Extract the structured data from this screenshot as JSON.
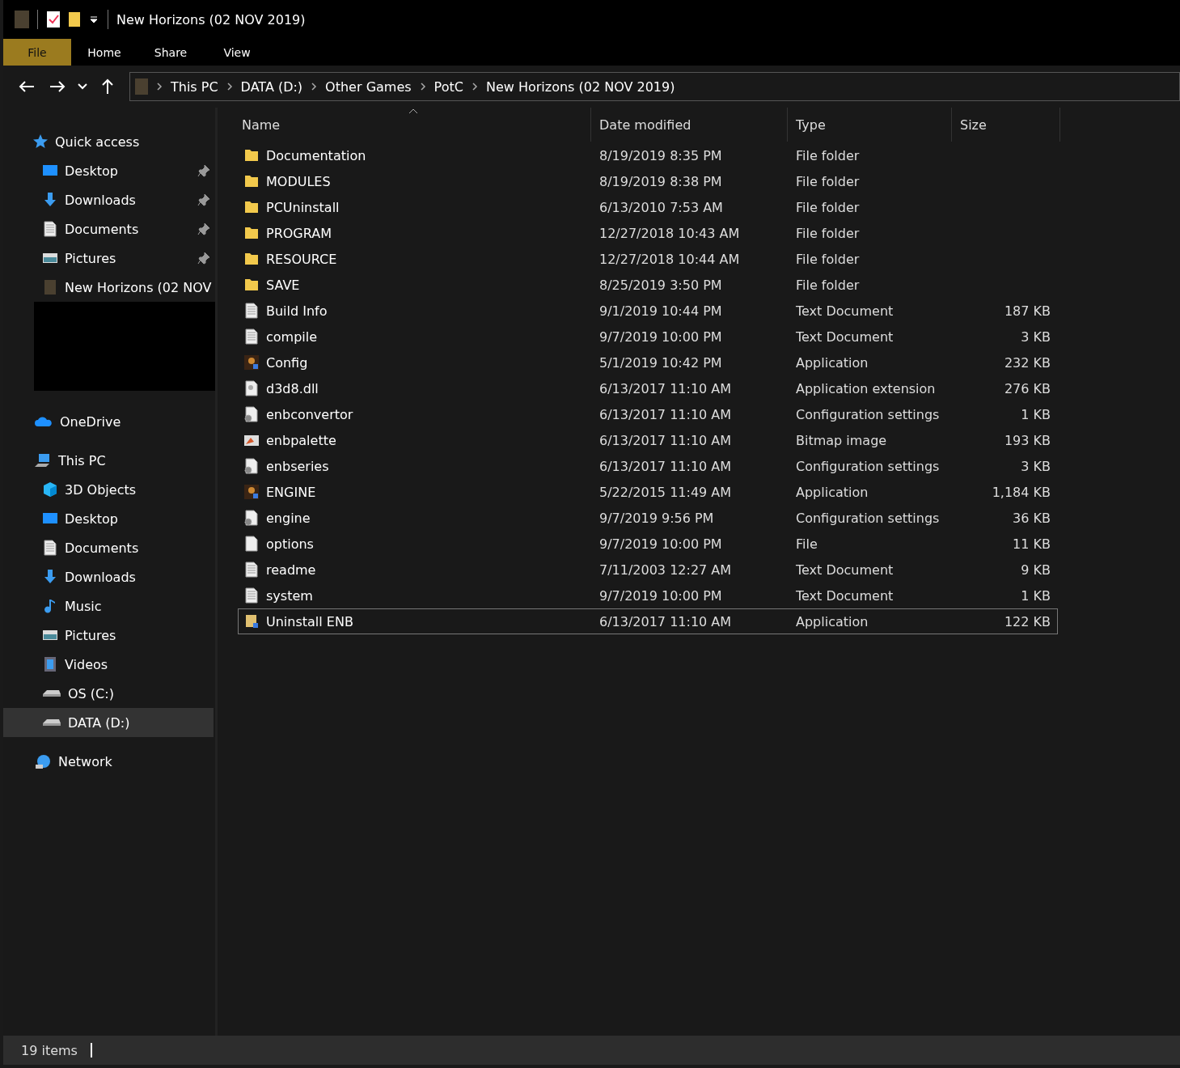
{
  "window": {
    "title": "New Horizons (02 NOV 2019)"
  },
  "ribbon_tabs": [
    {
      "label": "File",
      "selected": true
    },
    {
      "label": "Home",
      "selected": false
    },
    {
      "label": "Share",
      "selected": false
    },
    {
      "label": "View",
      "selected": false
    }
  ],
  "breadcrumb": [
    "This PC",
    "DATA (D:)",
    "Other Games",
    "PotC",
    "New Horizons (02 NOV 2019)"
  ],
  "sidebar": {
    "sections": [
      {
        "label": "Quick access",
        "kind": "star",
        "selected": false,
        "children": [
          {
            "label": "Desktop",
            "kind": "desktop",
            "pinned": true,
            "selected": false
          },
          {
            "label": "Downloads",
            "kind": "download",
            "pinned": true,
            "selected": false
          },
          {
            "label": "Documents",
            "kind": "document",
            "pinned": true,
            "selected": false
          },
          {
            "label": "Pictures",
            "kind": "picture",
            "pinned": true,
            "selected": false
          },
          {
            "label": "New Horizons (02 NOV",
            "kind": "game",
            "pinned": false,
            "selected": false
          }
        ],
        "redacted": true
      },
      {
        "label": "OneDrive",
        "kind": "cloud",
        "selected": false
      },
      {
        "label": "This PC",
        "kind": "pc",
        "selected": false,
        "children": [
          {
            "label": "3D Objects",
            "kind": "cube",
            "pinned": false,
            "selected": false
          },
          {
            "label": "Desktop",
            "kind": "desktop",
            "pinned": false,
            "selected": false
          },
          {
            "label": "Documents",
            "kind": "document",
            "pinned": false,
            "selected": false
          },
          {
            "label": "Downloads",
            "kind": "download",
            "pinned": false,
            "selected": false
          },
          {
            "label": "Music",
            "kind": "music",
            "pinned": false,
            "selected": false
          },
          {
            "label": "Pictures",
            "kind": "picture",
            "pinned": false,
            "selected": false
          },
          {
            "label": "Videos",
            "kind": "video",
            "pinned": false,
            "selected": false
          },
          {
            "label": "OS (C:)",
            "kind": "drive",
            "pinned": false,
            "selected": false
          },
          {
            "label": "DATA (D:)",
            "kind": "drive",
            "pinned": false,
            "selected": true
          }
        ]
      },
      {
        "label": "Network",
        "kind": "network",
        "selected": false
      }
    ]
  },
  "table": {
    "columns": [
      "Name",
      "Date modified",
      "Type",
      "Size"
    ],
    "rows": [
      {
        "kind": "folder",
        "name": "Documentation",
        "date": "8/19/2019 8:35 PM",
        "type": "File folder",
        "selected": false
      },
      {
        "kind": "folder",
        "name": "MODULES",
        "date": "8/19/2019 8:38 PM",
        "type": "File folder",
        "selected": false
      },
      {
        "kind": "folder",
        "name": "PCUninstall",
        "date": "6/13/2010 7:53 AM",
        "type": "File folder",
        "selected": false
      },
      {
        "kind": "folder",
        "name": "PROGRAM",
        "date": "12/27/2018 10:43 AM",
        "type": "File folder",
        "selected": false
      },
      {
        "kind": "folder",
        "name": "RESOURCE",
        "date": "12/27/2018 10:44 AM",
        "type": "File folder",
        "selected": false
      },
      {
        "kind": "folder",
        "name": "SAVE",
        "date": "8/25/2019 3:50 PM",
        "type": "File folder",
        "selected": false
      },
      {
        "kind": "text",
        "name": "Build Info",
        "date": "9/1/2019 10:44 PM",
        "type": "Text Document",
        "size": "187 KB",
        "selected": false
      },
      {
        "kind": "text",
        "name": "compile",
        "date": "9/7/2019 10:00 PM",
        "type": "Text Document",
        "size": "3 KB",
        "selected": false
      },
      {
        "kind": "app",
        "name": "Config",
        "date": "5/1/2019 10:42 PM",
        "type": "Application",
        "size": "232 KB",
        "selected": false
      },
      {
        "kind": "dll",
        "name": "d3d8.dll",
        "date": "6/13/2017 11:10 AM",
        "type": "Application extension",
        "size": "276 KB",
        "selected": false
      },
      {
        "kind": "config",
        "name": "enbconvertor",
        "date": "6/13/2017 11:10 AM",
        "type": "Configuration settings",
        "size": "1 KB",
        "selected": false
      },
      {
        "kind": "bitmap",
        "name": "enbpalette",
        "date": "6/13/2017 11:10 AM",
        "type": "Bitmap image",
        "size": "193 KB",
        "selected": false
      },
      {
        "kind": "config",
        "name": "enbseries",
        "date": "6/13/2017 11:10 AM",
        "type": "Configuration settings",
        "size": "3 KB",
        "selected": false
      },
      {
        "kind": "app",
        "name": "ENGINE",
        "date": "5/22/2015 11:49 AM",
        "type": "Application",
        "size": "1,184 KB",
        "selected": false
      },
      {
        "kind": "config",
        "name": "engine",
        "date": "9/7/2019 9:56 PM",
        "type": "Configuration settings",
        "size": "36 KB",
        "selected": false
      },
      {
        "kind": "file",
        "name": "options",
        "date": "9/7/2019 10:00 PM",
        "type": "File",
        "size": "11 KB",
        "selected": false
      },
      {
        "kind": "text",
        "name": "readme",
        "date": "7/11/2003 12:27 AM",
        "type": "Text Document",
        "size": "9 KB",
        "selected": false
      },
      {
        "kind": "text",
        "name": "system",
        "date": "9/7/2019 10:00 PM",
        "type": "Text Document",
        "size": "1 KB",
        "selected": false
      },
      {
        "kind": "installer",
        "name": "Uninstall ENB",
        "date": "6/13/2017 11:10 AM",
        "type": "Application",
        "size": "122 KB",
        "selected": true
      }
    ]
  },
  "status_bar": {
    "count": "19 items"
  }
}
